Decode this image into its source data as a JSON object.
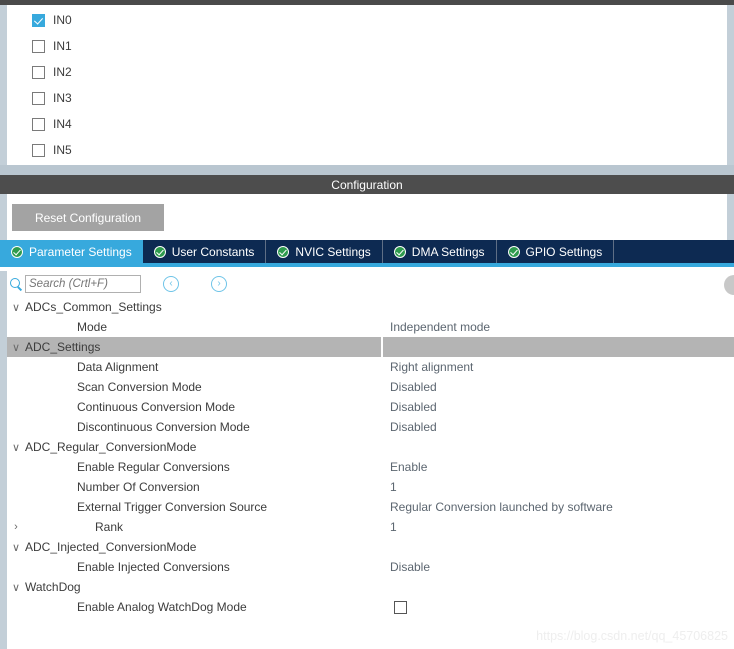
{
  "channels": {
    "items": [
      {
        "label": "IN0",
        "checked": true
      },
      {
        "label": "IN1",
        "checked": false
      },
      {
        "label": "IN2",
        "checked": false
      },
      {
        "label": "IN3",
        "checked": false
      },
      {
        "label": "IN4",
        "checked": false
      },
      {
        "label": "IN5",
        "checked": false
      }
    ]
  },
  "config": {
    "title": "Configuration",
    "reset_label": "Reset Configuration"
  },
  "tabs": [
    {
      "label": "Parameter Settings",
      "active": true
    },
    {
      "label": "User Constants",
      "active": false
    },
    {
      "label": "NVIC Settings",
      "active": false
    },
    {
      "label": "DMA Settings",
      "active": false
    },
    {
      "label": "GPIO Settings",
      "active": false
    }
  ],
  "search": {
    "placeholder": "Search (Crtl+F)",
    "value": "",
    "prev_label": "‹",
    "next_label": "›"
  },
  "tree": [
    {
      "kind": "group",
      "twisty": "∨",
      "label": "ADCs_Common_Settings",
      "value": "",
      "selected": false
    },
    {
      "kind": "param",
      "twisty": "",
      "label": "Mode",
      "value": "Independent mode",
      "selected": false
    },
    {
      "kind": "group",
      "twisty": "∨",
      "label": "ADC_Settings",
      "value": "",
      "selected": true
    },
    {
      "kind": "param",
      "twisty": "",
      "label": "Data Alignment",
      "value": "Right alignment",
      "selected": false
    },
    {
      "kind": "param",
      "twisty": "",
      "label": "Scan Conversion Mode",
      "value": "Disabled",
      "selected": false
    },
    {
      "kind": "param",
      "twisty": "",
      "label": "Continuous Conversion Mode",
      "value": "Disabled",
      "selected": false
    },
    {
      "kind": "param",
      "twisty": "",
      "label": "Discontinuous Conversion Mode",
      "value": "Disabled",
      "selected": false
    },
    {
      "kind": "group",
      "twisty": "∨",
      "label": "ADC_Regular_ConversionMode",
      "value": "",
      "selected": false
    },
    {
      "kind": "param",
      "twisty": "",
      "label": "Enable Regular Conversions",
      "value": "Enable",
      "selected": false
    },
    {
      "kind": "param",
      "twisty": "",
      "label": "Number Of Conversion",
      "value": "1",
      "selected": false
    },
    {
      "kind": "param",
      "twisty": "",
      "label": "External Trigger Conversion Source",
      "value": "Regular Conversion launched by software",
      "selected": false
    },
    {
      "kind": "subgroup",
      "twisty": "›",
      "label": "Rank",
      "value": "1",
      "selected": false
    },
    {
      "kind": "group",
      "twisty": "∨",
      "label": "ADC_Injected_ConversionMode",
      "value": "",
      "selected": false
    },
    {
      "kind": "param",
      "twisty": "",
      "label": "Enable Injected Conversions",
      "value": "Disable",
      "selected": false
    },
    {
      "kind": "group",
      "twisty": "∨",
      "label": "WatchDog",
      "value": "",
      "selected": false
    },
    {
      "kind": "param-check",
      "twisty": "",
      "label": "Enable Analog WatchDog Mode",
      "value": "",
      "checked": false,
      "selected": false
    }
  ],
  "watermark": "https://blog.csdn.net/qq_45706825",
  "colors": {
    "accent": "#37a9dd",
    "tab_bar": "#0d2a52",
    "title_bar": "#4d4d4d",
    "separator": "#b9c6d0",
    "panel_edge": "#c3cfd8",
    "selected_row": "#b4b4b4",
    "check_green": "#2e9b4e"
  }
}
